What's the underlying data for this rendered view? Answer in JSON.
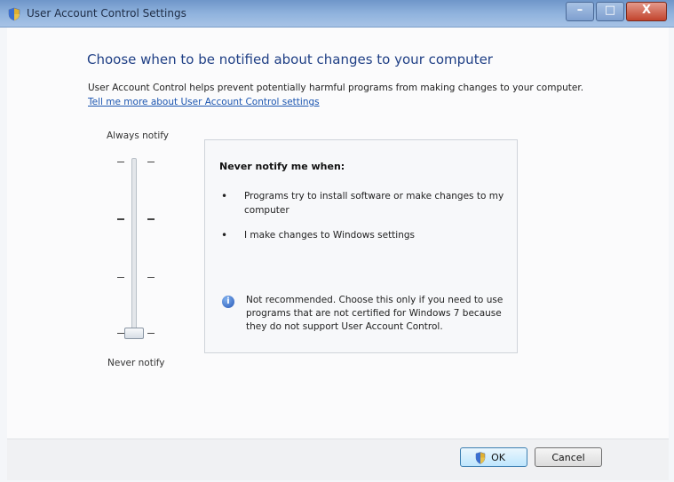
{
  "window": {
    "title": "User Account Control Settings",
    "minimize_glyph": "–",
    "maximize_glyph": "□",
    "close_glyph": "X"
  },
  "main": {
    "heading": "Choose when to be notified about changes to your computer",
    "description": "User Account Control helps prevent potentially harmful programs from making changes to your computer.",
    "learn_more_link": "Tell me more about User Account Control settings"
  },
  "slider": {
    "top_label": "Always notify",
    "bottom_label": "Never notify",
    "levels": 4,
    "selected_level": 1
  },
  "info": {
    "title": "Never notify me when:",
    "bullets": [
      "Programs try to install software or make changes to my computer",
      "I make changes to Windows settings"
    ],
    "bullet_glyph": "•",
    "info_glyph": "i",
    "warning": "Not recommended. Choose this only if you need to use programs that are not certified for Windows 7 because they do not support User Account Control."
  },
  "footer": {
    "ok_label": "OK",
    "cancel_label": "Cancel"
  },
  "icons": {
    "app": "shield-icon",
    "info": "info-icon",
    "ok_shield": "uac-shield-icon"
  }
}
